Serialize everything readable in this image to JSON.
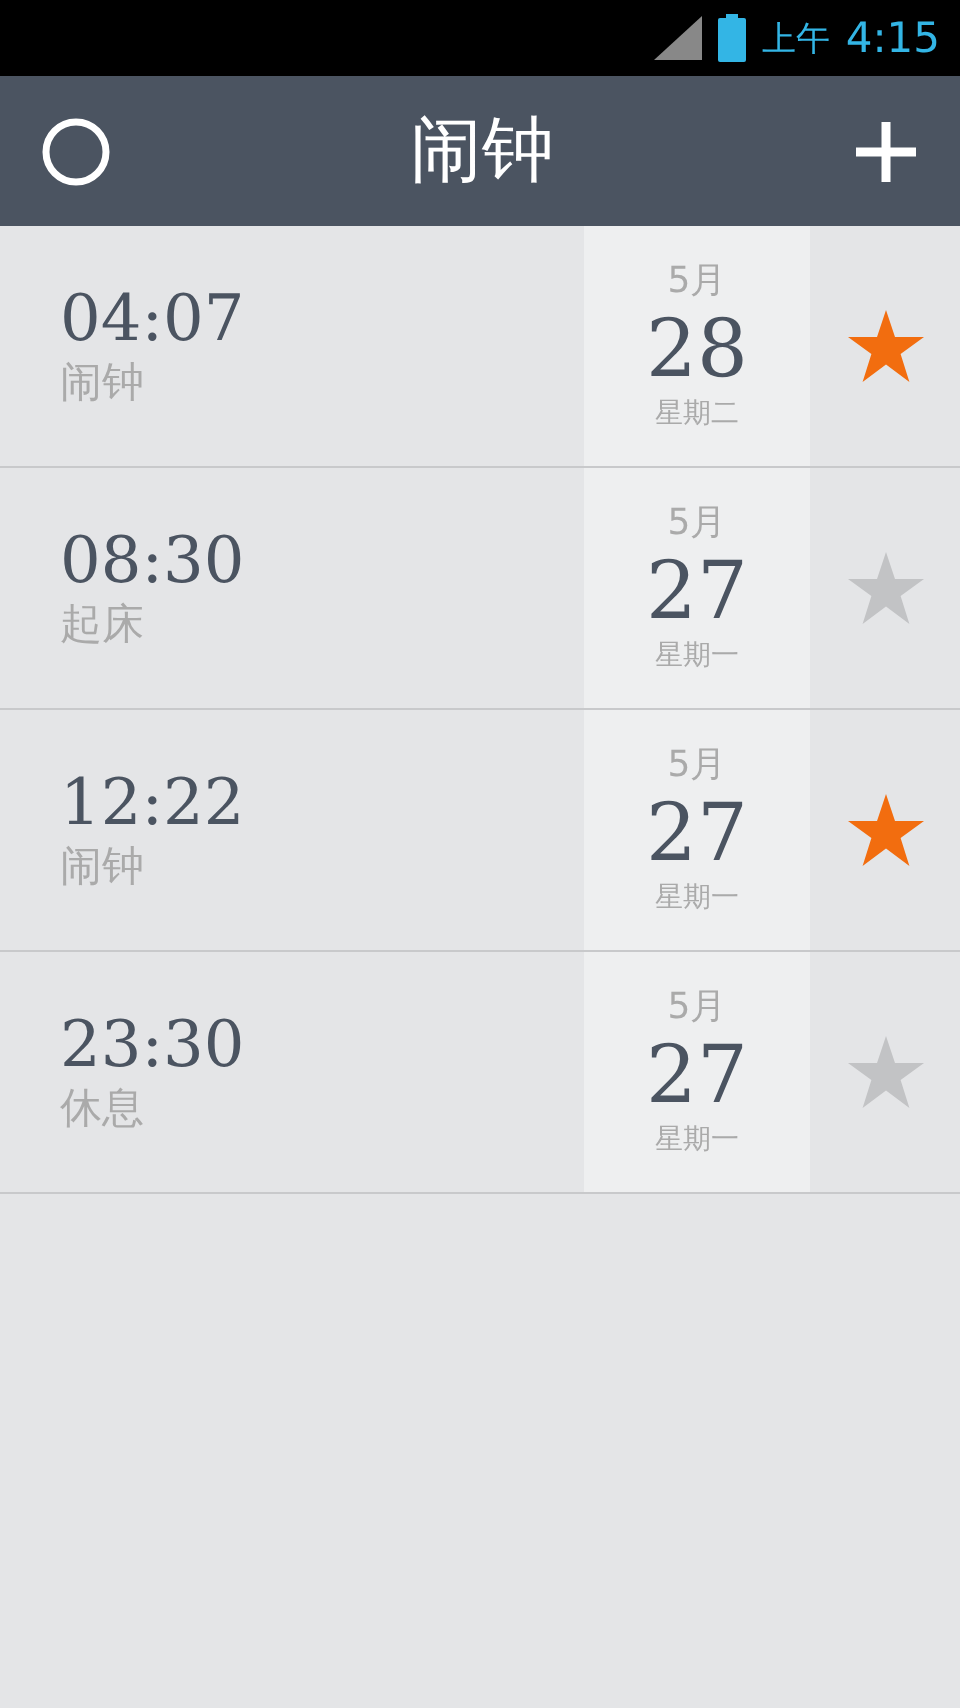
{
  "status_bar": {
    "ampm": "上午",
    "time": "4:15"
  },
  "header": {
    "title": "闹钟"
  },
  "alarms": [
    {
      "time": "04:07",
      "label": "闹钟",
      "month": "5月",
      "day": "28",
      "weekday": "星期二",
      "starred": true
    },
    {
      "time": "08:30",
      "label": "起床",
      "month": "5月",
      "day": "27",
      "weekday": "星期一",
      "starred": false
    },
    {
      "time": "12:22",
      "label": "闹钟",
      "month": "5月",
      "day": "27",
      "weekday": "星期一",
      "starred": true
    },
    {
      "time": "23:30",
      "label": "休息",
      "month": "5月",
      "day": "27",
      "weekday": "星期一",
      "starred": false
    }
  ]
}
